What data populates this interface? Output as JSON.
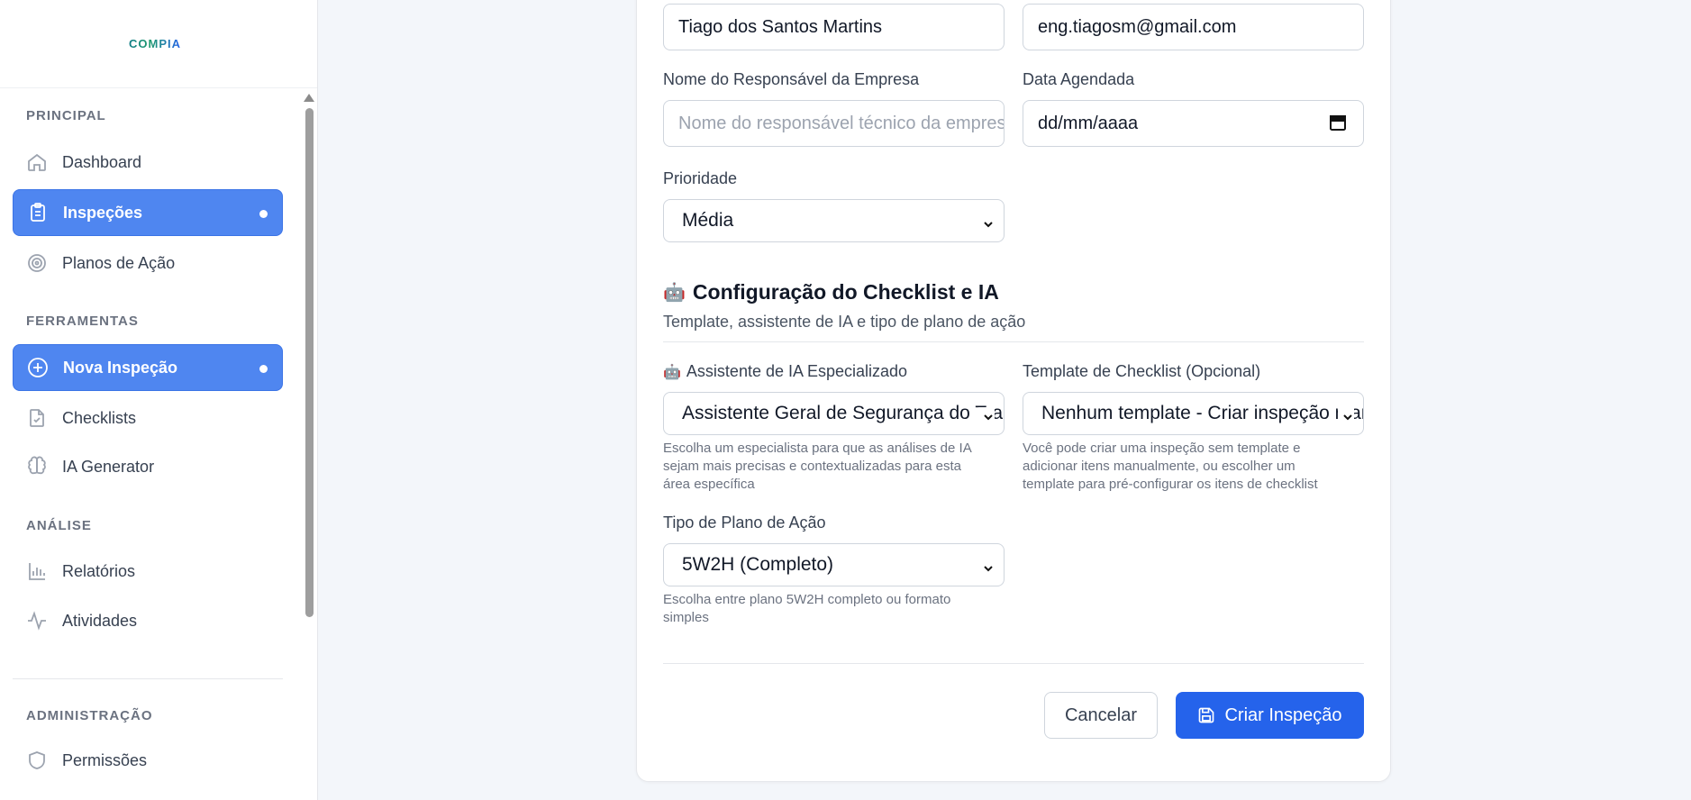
{
  "sidebar": {
    "logo": "COMPIA",
    "sections": {
      "principal": "PRINCIPAL",
      "ferramentas": "FERRAMENTAS",
      "analise": "ANÁLISE",
      "administracao": "ADMINISTRAÇÃO"
    },
    "items": {
      "dashboard": "Dashboard",
      "inspecoes": "Inspeções",
      "planos": "Planos de Ação",
      "nova_inspecao": "Nova Inspeção",
      "checklists": "Checklists",
      "ia_generator": "IA Generator",
      "relatorios": "Relatórios",
      "atividades": "Atividades",
      "permissoes": "Permissões"
    },
    "active_items": [
      "Inspeções",
      "Nova Inspeção"
    ]
  },
  "form": {
    "inspector_name_value": "Tiago dos Santos Martins",
    "inspector_email_value": "eng.tiagosm@gmail.com",
    "responsible_label": "Nome do Responsável da Empresa",
    "responsible_placeholder": "Nome do responsável técnico da empresa",
    "scheduled_label": "Data Agendada",
    "scheduled_value": "dd/mm/aaaa",
    "priority_label": "Prioridade",
    "priority_value": "Média",
    "checklist_section": {
      "icon": "robot-emoji",
      "title": "Configuração do Checklist e IA",
      "subtitle": "Template, assistente de IA e tipo de plano de ação"
    },
    "ai_assistant_label": "Assistente de IA Especializado",
    "ai_assistant_value": "Assistente Geral de Segurança do Trabalho",
    "ai_assistant_help": [
      "Escolha um especialista para que as análises de IA",
      "sejam mais precisas e contextualizadas para esta",
      "área específica"
    ],
    "template_label": "Template de Checklist (Opcional)",
    "template_value": "Nenhum template - Criar inspeção manual",
    "template_help": [
      "Você pode criar uma inspeção sem template e",
      "adicionar itens manualmente, ou escolher um",
      "template para pré-configurar os itens de checklist"
    ],
    "action_plan_label": "Tipo de Plano de Ação",
    "action_plan_value": "5W2H (Completo)",
    "action_plan_help": [
      "Escolha entre plano 5W2H completo ou formato",
      "simples"
    ],
    "cancel_label": "Cancelar",
    "submit_label": "Criar Inspeção"
  },
  "colors": {
    "primary": "#2563eb",
    "sidebar_active": "#4f86f0",
    "background": "#f3f6fa"
  }
}
